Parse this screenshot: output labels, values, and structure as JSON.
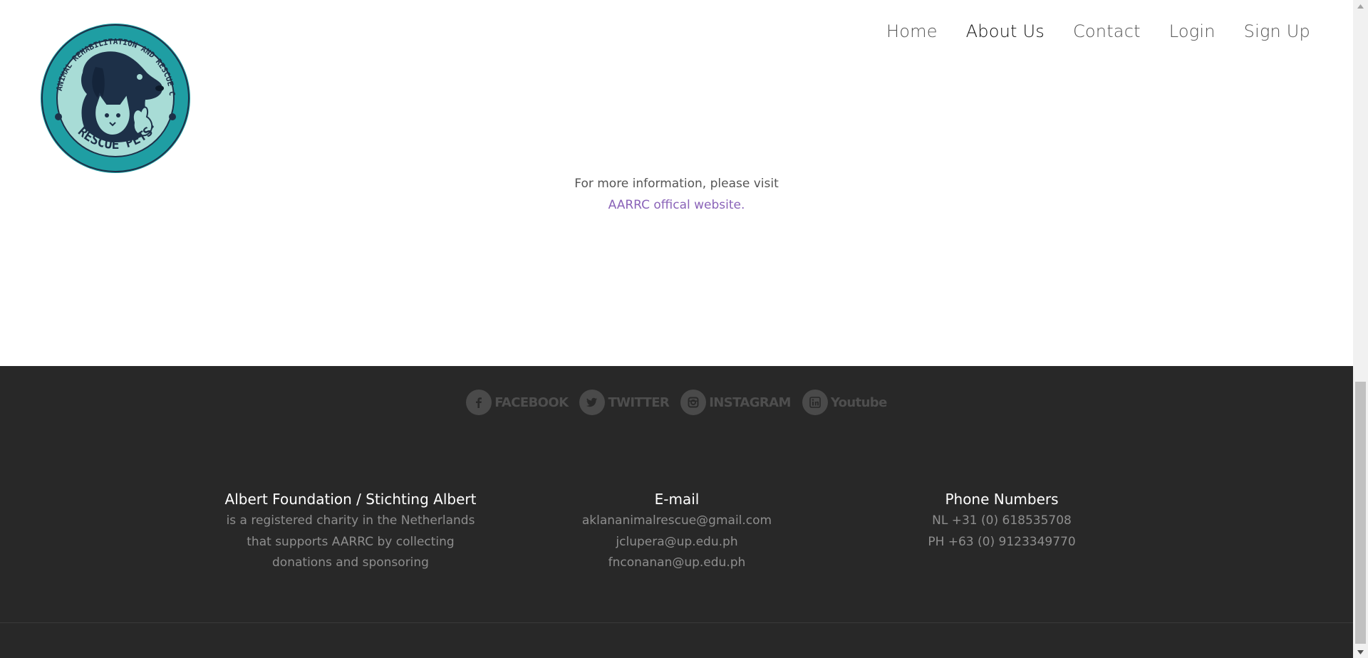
{
  "logo": {
    "ring_text": "AKLAN ANIMAL REHABILITATION AND RESCUE CENTER",
    "bottom_text": "RESCUE PETS",
    "colors": {
      "ring": "#1f9ea3",
      "inner": "#a8dcd6",
      "silhouette": "#1d3048"
    }
  },
  "nav": {
    "items": [
      {
        "label": "Home",
        "active": false
      },
      {
        "label": "About Us",
        "active": true
      },
      {
        "label": "Contact",
        "active": false
      },
      {
        "label": "Login",
        "active": false
      },
      {
        "label": "Sign Up",
        "active": false
      }
    ]
  },
  "info": {
    "text": "For more information, please visit",
    "link_text": "AARRC offical website.",
    "link_color": "#8a63b8"
  },
  "footer": {
    "social": [
      {
        "icon": "facebook-icon",
        "label": "FACEBOOK"
      },
      {
        "icon": "twitter-icon",
        "label": "TWITTER"
      },
      {
        "icon": "instagram-icon",
        "label": "INSTAGRAM"
      },
      {
        "icon": "linkedin-icon",
        "label": "Youtube"
      }
    ],
    "columns": [
      {
        "title": "Albert Foundation / Stichting Albert",
        "lines": [
          "is a registered charity in the Netherlands",
          "that supports AARRC by collecting",
          "donations and sponsoring"
        ]
      },
      {
        "title": "E-mail",
        "lines": [
          "aklananimalrescue@gmail.com",
          "jclupera@up.edu.ph",
          "fnconanan@up.edu.ph"
        ]
      },
      {
        "title": "Phone Numbers",
        "lines": [
          "NL +31 (0) 618535708",
          "PH +63 (0) 9123349770"
        ]
      }
    ],
    "background": "#282828"
  }
}
